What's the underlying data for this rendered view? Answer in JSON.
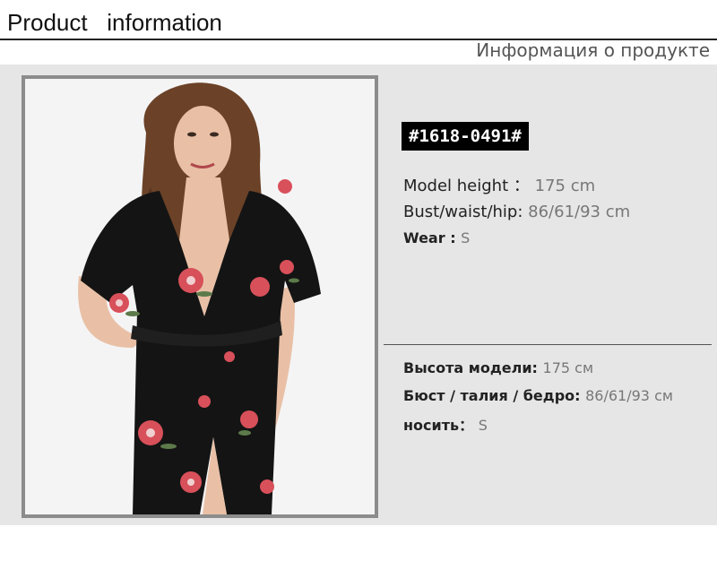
{
  "header": {
    "title_en": "Product   information",
    "title_ru": "Информация о продукте"
  },
  "product": {
    "sku": "#1618-0491#"
  },
  "specs_en": {
    "height_label": "Model height ：",
    "height_value": "175 cm",
    "measure_label": "Bust/waist/hip:",
    "measure_value": "86/61/93 cm",
    "wear_label": "Wear :",
    "wear_value": "S"
  },
  "specs_ru": {
    "height_label": "Высота модели:",
    "height_value": "175 см",
    "measure_label": "Бюст / талия / бедро:",
    "measure_value": "86/61/93 см",
    "wear_label": "носить：",
    "wear_value": "S"
  },
  "colors": {
    "panel_bg": "#e6e6e6",
    "frame": "#8c8c8c",
    "sku_bg": "#000000",
    "dress": "#141414",
    "flower": "#d8505a"
  }
}
